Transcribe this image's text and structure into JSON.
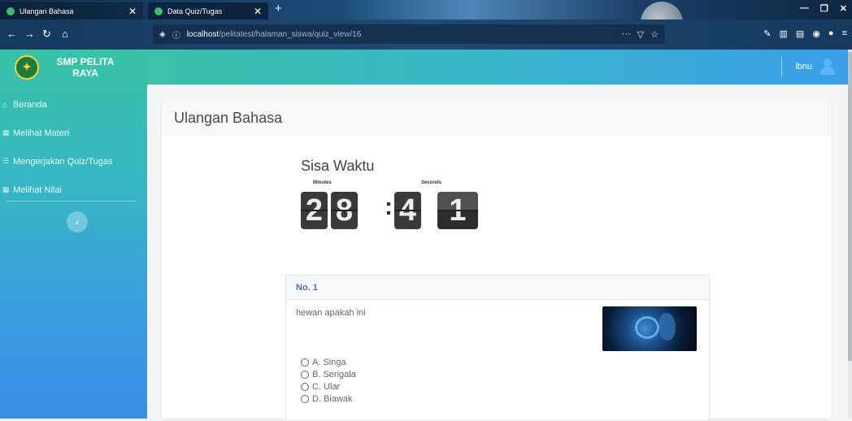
{
  "browser": {
    "tabs": [
      {
        "title": "Ulangan Bahasa",
        "active": false
      },
      {
        "title": "Data Quiz/Tugas",
        "active": true
      }
    ],
    "url_host": "localhost",
    "url_path": "/pelitatest/halaman_siswa/quiz_view/16"
  },
  "brand": {
    "name": "SMP PELITA RAYA"
  },
  "sidebar": {
    "items": [
      {
        "label": "Beranda"
      },
      {
        "label": "Melihat Materi"
      },
      {
        "label": "Mengerjakan Quiz/Tugas"
      },
      {
        "label": "Melihat Nilai"
      }
    ]
  },
  "header": {
    "username": "ibnu"
  },
  "page": {
    "title": "Ulangan Bahasa"
  },
  "timer": {
    "title": "Sisa Waktu",
    "minutes_label": "Minutes",
    "seconds_label": "Seconds",
    "digits": [
      "2",
      "8",
      "4",
      "1"
    ]
  },
  "question": {
    "number": "No. 1",
    "text": "hewan apakah ini",
    "options": [
      "A. Singa",
      "B. Serigala",
      "C. Ular",
      "D. Biawak"
    ]
  },
  "colors": {
    "sidebar_top": "#38c2a6",
    "sidebar_bottom": "#3a8ee8",
    "question_header": "#4b6fb5"
  }
}
